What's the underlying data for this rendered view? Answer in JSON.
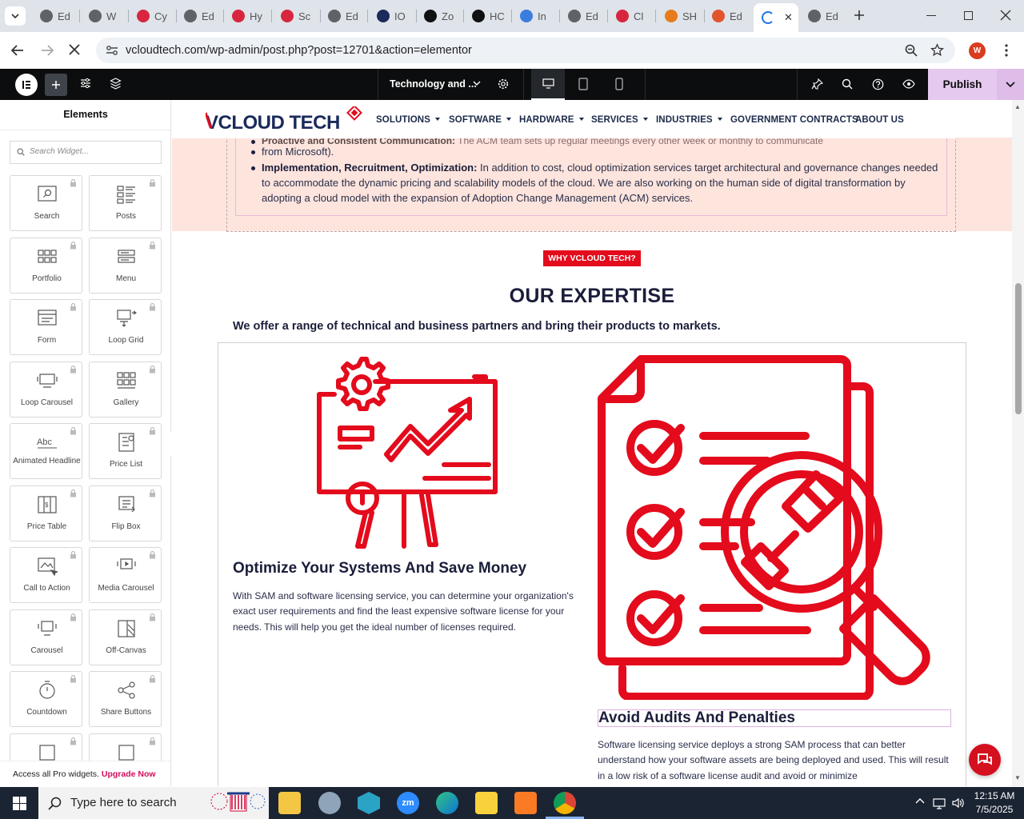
{
  "browser": {
    "tabs": [
      {
        "label": "Ed",
        "color": "#5f6368"
      },
      {
        "label": "W",
        "color": "#5f6368"
      },
      {
        "label": "Cy",
        "color": "#d7263d"
      },
      {
        "label": "Ed",
        "color": "#5f6368"
      },
      {
        "label": "Hy",
        "color": "#d7263d"
      },
      {
        "label": "Sc",
        "color": "#d7263d"
      },
      {
        "label": "Ed",
        "color": "#5f6368"
      },
      {
        "label": "IO",
        "color": "#1a2a5a"
      },
      {
        "label": "Zo",
        "color": "#111111"
      },
      {
        "label": "HC",
        "color": "#111111"
      },
      {
        "label": "In",
        "color": "#3b7ddd"
      },
      {
        "label": "Ed",
        "color": "#5f6368"
      },
      {
        "label": "Cl",
        "color": "#d7263d"
      },
      {
        "label": "SH",
        "color": "#e77c1a"
      },
      {
        "label": "Ed",
        "color": "#e0542e"
      },
      {
        "label": "",
        "color": "#1a73e8",
        "active": true
      },
      {
        "label": "Ed",
        "color": "#5f6368"
      }
    ],
    "url": "vcloudtech.com/wp-admin/post.php?post=12701&action=elementor",
    "profile_initial": "W"
  },
  "editor": {
    "page_title": "Technology and ...",
    "publish_label": "Publish"
  },
  "panel": {
    "title": "Elements",
    "search_placeholder": "Search Widget...",
    "widgets": [
      {
        "label": "Search",
        "icon": "search-widget-icon"
      },
      {
        "label": "Posts",
        "icon": "posts-icon"
      },
      {
        "label": "Portfolio",
        "icon": "portfolio-icon"
      },
      {
        "label": "Menu",
        "icon": "menu-icon"
      },
      {
        "label": "Form",
        "icon": "form-icon"
      },
      {
        "label": "Loop Grid",
        "icon": "loop-grid-icon"
      },
      {
        "label": "Loop Carousel",
        "icon": "loop-carousel-icon"
      },
      {
        "label": "Gallery",
        "icon": "gallery-icon"
      },
      {
        "label": "Animated Headline",
        "icon": "animated-headline-icon"
      },
      {
        "label": "Price List",
        "icon": "price-list-icon"
      },
      {
        "label": "Price Table",
        "icon": "price-table-icon"
      },
      {
        "label": "Flip Box",
        "icon": "flip-box-icon"
      },
      {
        "label": "Call to Action",
        "icon": "call-to-action-icon"
      },
      {
        "label": "Media Carousel",
        "icon": "media-carousel-icon"
      },
      {
        "label": "Carousel",
        "icon": "carousel-icon"
      },
      {
        "label": "Off-Canvas",
        "icon": "off-canvas-icon"
      },
      {
        "label": "Countdown",
        "icon": "countdown-icon"
      },
      {
        "label": "Share Buttons",
        "icon": "share-buttons-icon"
      },
      {
        "label": "",
        "icon": "widget-icon"
      },
      {
        "label": "",
        "icon": "widget-icon"
      }
    ],
    "promo_text": "Access all Pro widgets.",
    "promo_link": "Upgrade Now"
  },
  "site": {
    "logo_text": "VCLOUD TECH",
    "brand_color": "#e30b1c",
    "nav": [
      {
        "label": "SOLUTIONS",
        "caret": true
      },
      {
        "label": "SOFTWARE",
        "caret": true
      },
      {
        "label": "HARDWARE",
        "caret": true
      },
      {
        "label": "SERVICES",
        "caret": true
      },
      {
        "label": "INDUSTRIES",
        "caret": true
      },
      {
        "label": "GOVERNMENT CONTRACTS",
        "caret": false
      },
      {
        "label": "ABOUT US",
        "caret": false
      }
    ],
    "bullets": [
      {
        "bold": "",
        "text": "from Microsoft)."
      },
      {
        "bold": "Implementation, Recruitment, Optimization:",
        "text": " In addition to cost, cloud optimization services target architectural and governance changes needed to accommodate the dynamic pricing and scalability models of the cloud. We are also working on the human side of digital transformation by adopting a cloud model with the expansion of Adoption Change Management (ACM) services."
      }
    ],
    "badge": "WHY VCLOUD TECH?",
    "expertise_title": "OUR EXPERTISE",
    "expertise_sub": "We offer a range of technical and business partners and bring their products to markets.",
    "card1": {
      "title": "Optimize Your Systems And Save Money",
      "text": "With SAM and software licensing service, you can determine your organization's exact user requirements and find the least expensive software license for your needs. This will help you get the ideal number of licenses required."
    },
    "card2": {
      "title": "Avoid Audits And Penalties",
      "text": "Software licensing service deploys a strong SAM process that can better understand how your software assets are being deployed and used. This will result in a low risk of a software license audit and avoid or minimize"
    }
  },
  "taskbar": {
    "search_placeholder": "Type here to search",
    "time": "12:15 AM",
    "date": "7/5/2025"
  }
}
